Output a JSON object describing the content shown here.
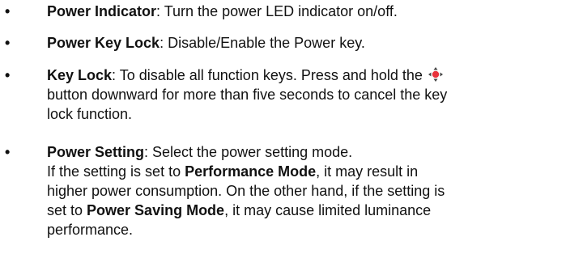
{
  "items": [
    {
      "term": "Power Indicator",
      "desc": ": Turn the power LED indicator on/off."
    },
    {
      "term": "Power Key Lock",
      "desc": ": Disable/Enable the Power key."
    },
    {
      "term": "Key Lock",
      "desc_before_icon": ": To disable all function keys. Press and hold the ",
      "icon": "joystick-button-icon",
      "desc_after_icon_line1": " button downward for more than five seconds to cancel the key",
      "desc_line3": "lock function."
    },
    {
      "term": "Power Setting",
      "desc": ": Select the power setting mode.",
      "line2_prefix": "If the setting is set to ",
      "line2_term": "Performance Mode",
      "line2_suffix": ", it may result in",
      "line3": "higher power consumption. On the other hand, if the setting is",
      "line4_prefix": "set to ",
      "line4_term": "Power Saving Mode",
      "line4_suffix": ", it may cause limited luminance",
      "line5": "performance."
    }
  ],
  "bullet_char": "•",
  "colors": {
    "text": "#111111",
    "icon_center": "#e8323c",
    "icon_arrows": "#444444"
  }
}
